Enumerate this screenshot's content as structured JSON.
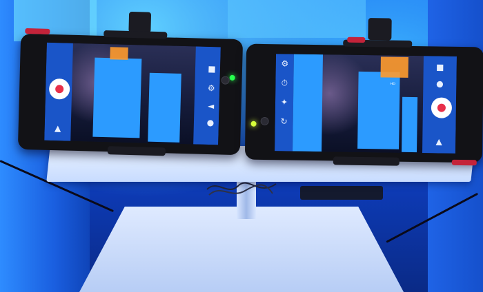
{
  "scene": {
    "description_colors": {
      "backdrop": "#1b6df0",
      "stand": "#dfeaff",
      "phone_body": "#121216",
      "screen_blue": "#2c9bff",
      "led_left": "#27ff4e",
      "led_right": "#d6ff3a",
      "shutter_red": "#e8304a"
    }
  },
  "left_phone": {
    "icons": [
      "shutter-icon",
      "flash-icon",
      "settings-icon",
      "back-icon",
      "home-icon",
      "recents-icon"
    ]
  },
  "right_phone": {
    "icons": [
      "settings-icon",
      "timer-icon",
      "effects-icon",
      "camera-switch-icon",
      "shutter-icon",
      "gallery-icon",
      "recents-icon",
      "home-icon",
      "back-icon"
    ]
  }
}
